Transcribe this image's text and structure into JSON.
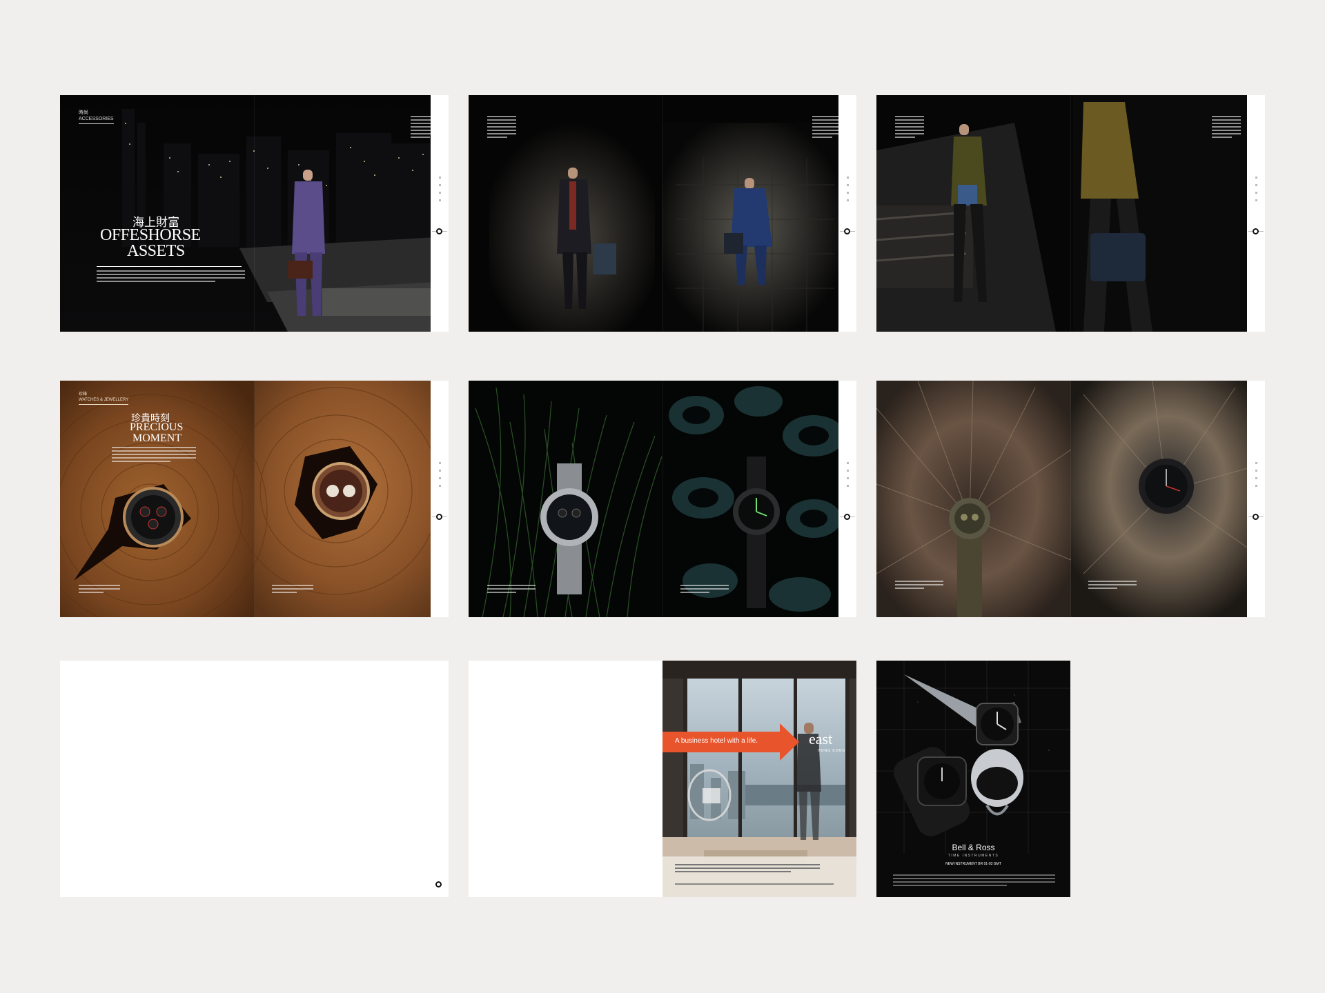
{
  "spreads": {
    "offshore": {
      "section_zh": "時尚",
      "section_en": "ACCESSORIES",
      "title_zh": "海上財富",
      "title_en_1": "OFFESHORSE",
      "title_en_2": "ASSETS"
    },
    "precious": {
      "section_zh": "珍錶",
      "section_en": "WATCHES & JEWELLERY",
      "title_zh": "珍貴時刻",
      "title_en_1": "PRECIOUS",
      "title_en_2": "MOMENT"
    },
    "east_ad": {
      "banner": "A business hotel with a life.",
      "logo": "east",
      "logo_sub": "HONG KONG"
    },
    "bell_ross_ad": {
      "brand": "Bell & Ross",
      "brand_sub": "TIME INSTRUMENTS",
      "model": "NEW INSTRUMENT BR 01-93 GMT"
    }
  },
  "colors": {
    "background": "#f0efed",
    "east_banner": "#e8542c",
    "bell_ross_model": "#d9402a"
  }
}
